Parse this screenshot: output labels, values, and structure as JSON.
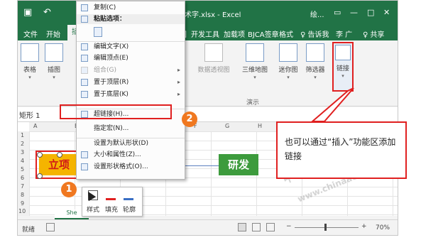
{
  "titlebar": {
    "document": "形状艺术字.xlsx - Excel",
    "user": "绘...",
    "ribbon_toggle": "▭",
    "minimize": "—",
    "restore": "□",
    "close": "✕"
  },
  "tabs": {
    "file": "文件",
    "home": "开始",
    "insert": "插",
    "view": "视图",
    "developer": "开发工具",
    "addins": "加载项",
    "bjca": "BJCA签章",
    "format": "格式",
    "tellme": "♀ 告诉我",
    "user": "李 广",
    "share": "♀ 共享"
  },
  "ribbon": {
    "tables": "表格",
    "illustrations": "插图",
    "pivotchart": "数据透视图",
    "map3d": "三维地图",
    "sparklines": "迷你图",
    "filters": "筛选器",
    "links": "链接",
    "tours_label": "演示"
  },
  "formula_bar": {
    "name_box": "矩形 1"
  },
  "columns": [
    "A",
    "B",
    "C",
    "D",
    "E",
    "F",
    "G",
    "H",
    "I"
  ],
  "rows": [
    "1",
    "2",
    "3",
    "4",
    "5",
    "6",
    "7",
    "8",
    "9",
    "10"
  ],
  "shapes": {
    "lixiang": "立项",
    "yanjiu": "研",
    "yanfa": "研发"
  },
  "context_menu": {
    "copy": "复制(C)",
    "paste_options": "粘贴选项：",
    "edit_text": "编辑文字(X)",
    "edit_points": "编辑顶点(E)",
    "group": "组合(G)",
    "bring_front": "置于顶层(R)",
    "send_back": "置于底层(K)",
    "hyperlink": "超链接(H)...",
    "assign_macro": "指定宏(N)...",
    "set_default": "设置为默认形状(D)",
    "size_props": "大小和属性(Z)...",
    "format_shape": "设置形状格式(O)..."
  },
  "mini_toolbar": {
    "style": "样式",
    "fill": "填充",
    "outline": "轮廓"
  },
  "badges": {
    "step1": "1",
    "step2": "2"
  },
  "callout": {
    "text": "也可以通过“插入”功能区添加链接"
  },
  "sheet_tab": "She",
  "statusbar": {
    "ready": "就绪",
    "zoom": "70%",
    "minus": "−",
    "plus": "+"
  },
  "watermark": {
    "text1": "中华会计网校",
    "text2": "www.chinaacc.com"
  },
  "colors": {
    "excel_green": "#217346",
    "highlight_red": "#e02020",
    "badge_orange": "#f07820"
  }
}
